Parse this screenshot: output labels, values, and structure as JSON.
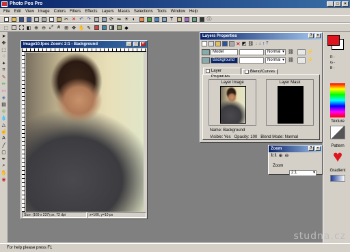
{
  "app": {
    "title": "Photo Pos Pro"
  },
  "menu": [
    "File",
    "Edit",
    "View",
    "Image",
    "Colors",
    "Filters",
    "Effects",
    "Layers",
    "Masks",
    "Selections",
    "Tools",
    "Window",
    "Help"
  ],
  "document": {
    "title": "Image10.fpos  Zoom: 2:1 - Background",
    "status_size": "Size: (169 x 237) px, 72 dpi",
    "status_coords": "x=100, y=10 px"
  },
  "layers": {
    "title": "Layers Properties",
    "rows": [
      {
        "name": "Model",
        "mode": "Normal",
        "selected": false
      },
      {
        "name": "Background",
        "mode": "Normal",
        "selected": true
      }
    ],
    "tabs": [
      "Layer Properties",
      "Blend/Curves"
    ],
    "layer_image_label": "Layer Image",
    "layer_mask_label": "Layer Mask",
    "name_line": "Name: Background",
    "info_line": "Visible: Yes   Opacity: 100   Blend Mode: Normal"
  },
  "zoom": {
    "title": "Zoom",
    "ratio": "1:1",
    "label": "Zoom",
    "value": "2:1"
  },
  "right_panel": {
    "texture_label": "Texture",
    "pattern_label": "Pattern",
    "gradient_label": "Gradient",
    "r_label": "R -",
    "g_label": "G -",
    "b_label": "B -"
  },
  "colors": {
    "foreground": "#e0141e",
    "accent": "#0a246a"
  },
  "status": "For help please press F1",
  "watermark": "studna.cz"
}
